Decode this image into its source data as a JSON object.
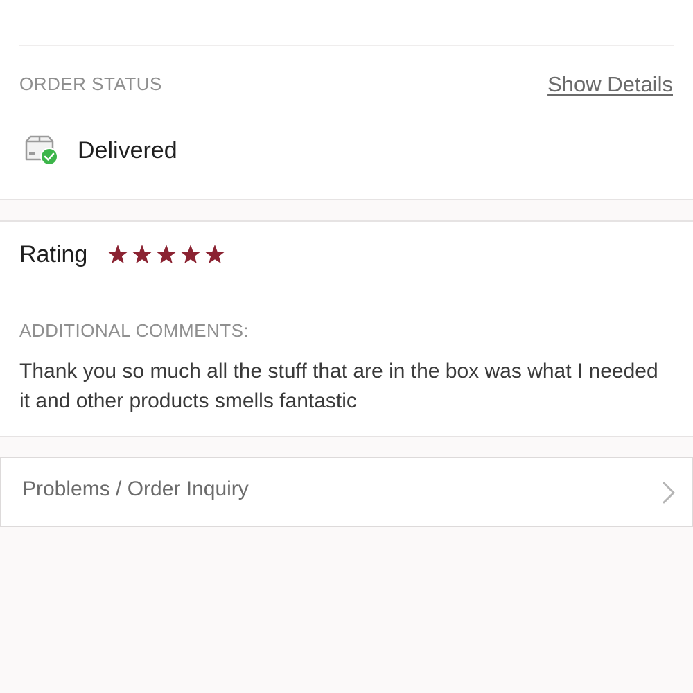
{
  "order_status": {
    "heading": "ORDER STATUS",
    "show_details_label": "Show Details",
    "status_icon": "box-check-icon",
    "status_text": "Delivered",
    "status_color": "#3cb54a"
  },
  "rating": {
    "label": "Rating",
    "stars": 5,
    "max_stars": 5,
    "star_color": "#8b2332"
  },
  "comments": {
    "heading": "ADDITIONAL COMMENTS:",
    "text": "Thank you so much all the stuff that are in the box was what I needed it and other products smells fantastic"
  },
  "inquiry": {
    "label": "Problems / Order Inquiry",
    "icon": "chevron-right-icon"
  }
}
